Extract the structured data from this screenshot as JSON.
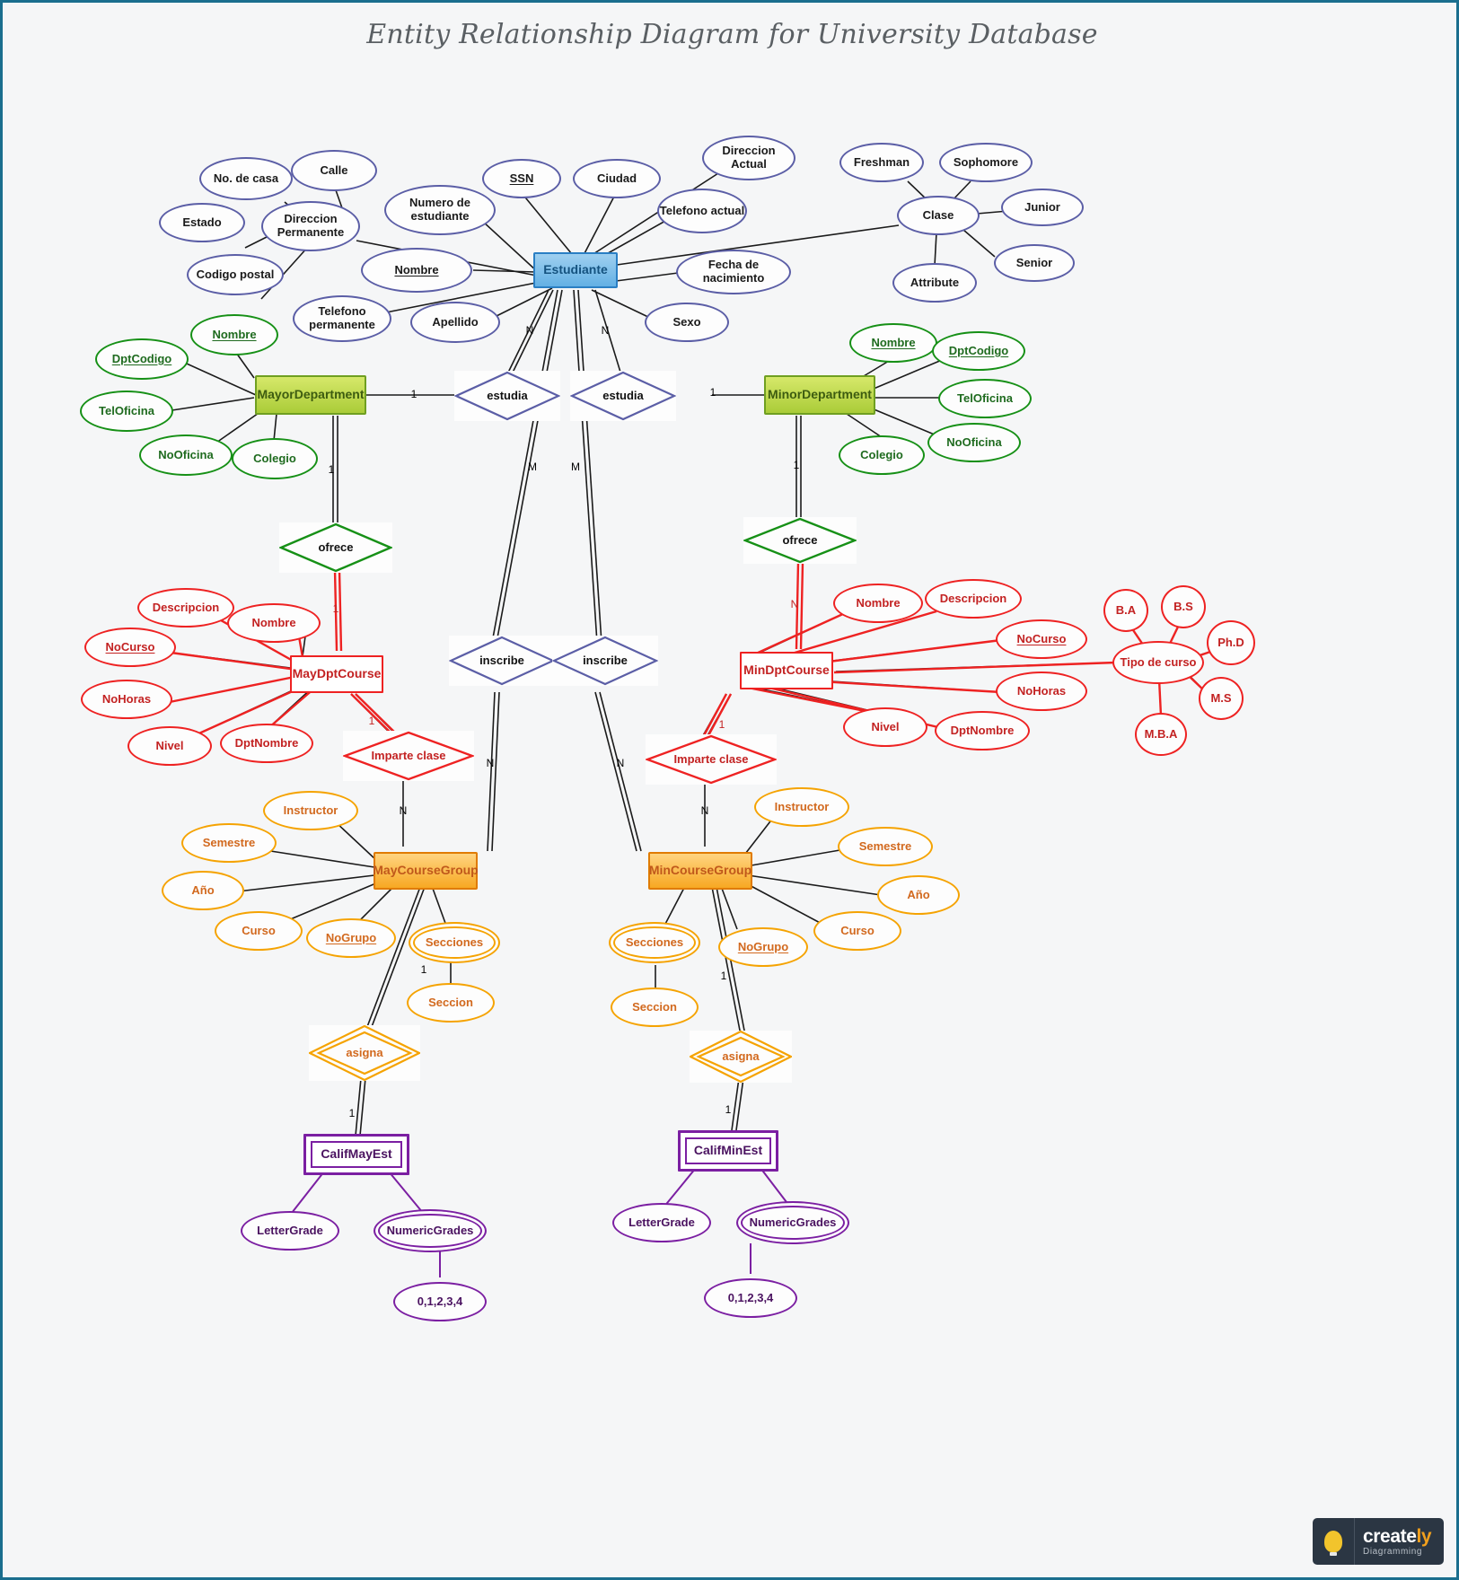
{
  "title": "Entity Relationship Diagram for University Database",
  "brand": {
    "word_a": "create",
    "word_b": "ly",
    "tagline": "Diagramming",
    "icon": "lightbulb-icon"
  },
  "colors": {
    "student_blue": "#5b5ea6",
    "department_green": "#169016",
    "course_red": "#ee2222",
    "coursegroup_orange": "#f5a302",
    "grade_purple": "#7b1fa2",
    "canvas": "#f5f6f7",
    "border": "#1a6e8e"
  },
  "entities": {
    "estudiante": "Estudiante",
    "mayor_department": "MayorDepartment",
    "minor_department": "MinorDepartment",
    "may_dpt_course": "MayDptCourse",
    "min_dpt_course": "MinDptCourse",
    "may_course_group": "MayCourseGroup",
    "min_course_group": "MinCourseGroup",
    "calif_may_est": "CalifMayEst",
    "calif_min_est": "CalifMinEst"
  },
  "relationships": {
    "estudia_left": "estudia",
    "estudia_right": "estudia",
    "ofrece_left": "ofrece",
    "ofrece_right": "ofrece",
    "inscribe_left": "inscribe",
    "inscribe_right": "inscribe",
    "imparte_left": "Imparte clase",
    "imparte_right": "Imparte clase",
    "asigna_left": "asigna",
    "asigna_right": "asigna"
  },
  "student_attributes": {
    "no_de_casa": "No. de casa",
    "calle": "Calle",
    "estado": "Estado",
    "direccion_permanente": "Direccion Permanente",
    "codigo_postal": "Codigo postal",
    "numero_de_estudiante": "Numero de estudiante",
    "ssn": "SSN",
    "ciudad": "Ciudad",
    "direccion_actual": "Direccion Actual",
    "telefono_actual": "Telefono actual",
    "nombre": "Nombre",
    "fecha_de_nacimiento": "Fecha de nacimiento",
    "telefono_permanente": "Telefono permanente",
    "apellido": "Apellido",
    "sexo": "Sexo"
  },
  "clase_cluster": {
    "clase": "Clase",
    "freshman": "Freshman",
    "sophomore": "Sophomore",
    "junior": "Junior",
    "senior": "Senior",
    "attribute": "Attribute"
  },
  "mayor_dept_attributes": {
    "nombre": "Nombre",
    "dptcodigo": "DptCodigo",
    "teloficina": "TelOficina",
    "nooficina": "NoOficina",
    "colegio": "Colegio"
  },
  "minor_dept_attributes": {
    "nombre": "Nombre",
    "dptcodigo": "DptCodigo",
    "teloficina": "TelOficina",
    "nooficina": "NoOficina",
    "colegio": "Colegio"
  },
  "may_course_attributes": {
    "descripcion": "Descripcion",
    "nombre": "Nombre",
    "nocurso": "NoCurso",
    "nohoras": "NoHoras",
    "nivel": "Nivel",
    "dptnombre": "DptNombre"
  },
  "min_course_attributes": {
    "nombre": "Nombre",
    "descripcion": "Descripcion",
    "nocurso": "NoCurso",
    "nohoras": "NoHoras",
    "nivel": "Nivel",
    "dptnombre": "DptNombre"
  },
  "tipo_curso_cluster": {
    "tipo_de_curso": "Tipo de curso",
    "ba": "B.A",
    "bs": "B.S",
    "phd": "Ph.D",
    "ms": "M.S",
    "mba": "M.B.A"
  },
  "may_group_attributes": {
    "instructor": "Instructor",
    "semestre": "Semestre",
    "ano": "Año",
    "curso": "Curso",
    "nogrupo": "NoGrupo",
    "secciones": "Secciones",
    "seccion": "Seccion"
  },
  "min_group_attributes": {
    "instructor": "Instructor",
    "semestre": "Semestre",
    "ano": "Año",
    "curso": "Curso",
    "nogrupo": "NoGrupo",
    "secciones": "Secciones",
    "seccion": "Seccion"
  },
  "may_grade_attributes": {
    "lettergrade": "LetterGrade",
    "numericgrades": "NumericGrades",
    "values": "0,1,2,3,4"
  },
  "min_grade_attributes": {
    "lettergrade": "LetterGrade",
    "numericgrades": "NumericGrades",
    "values": "0,1,2,3,4"
  },
  "cardinalities": {
    "c1": "M",
    "c2": "N",
    "c3": "M",
    "c4": "M",
    "c5": "1",
    "c6": "1",
    "c7": "1",
    "c8": "1",
    "c9": "N",
    "c10": "N",
    "c11": "1",
    "c12": "1",
    "c13": "N",
    "c14": "N",
    "c15": "N",
    "c16": "N",
    "c17": "1",
    "c18": "1",
    "c19": "1",
    "c20": "1"
  }
}
